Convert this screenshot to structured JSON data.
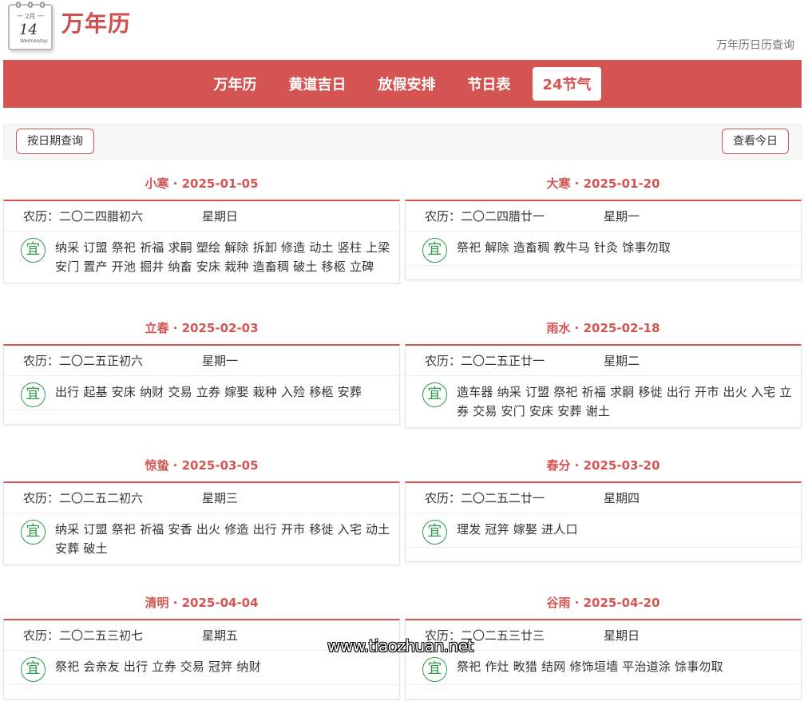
{
  "site": {
    "title": "万年历",
    "subtitle": "万年历日历查询",
    "logo": {
      "month": "一 2月 一",
      "day": "14",
      "week": "Wednesday"
    }
  },
  "nav": {
    "items": [
      {
        "label": "万年历",
        "active": false
      },
      {
        "label": "黄道吉日",
        "active": false
      },
      {
        "label": "放假安排",
        "active": false
      },
      {
        "label": "节日表",
        "active": false
      },
      {
        "label": "24节气",
        "active": true
      }
    ]
  },
  "toolbar": {
    "query_by_date": "按日期查询",
    "view_today": "查看今日"
  },
  "terms": [
    {
      "name": "小寒",
      "date": "2025-01-05",
      "header": "小寒 · 2025-01-05",
      "lunar": "农历：二〇二四腊初六",
      "weekday": "星期日",
      "yi": "纳采 订盟 祭祀 祈福 求嗣 塑绘 解除 拆卸 修造 动土 竖柱 上梁 安门 置产 开池 掘井 纳畜 安床 栽种 造畜稠 破土 移柩 立碑"
    },
    {
      "name": "大寒",
      "date": "2025-01-20",
      "header": "大寒 · 2025-01-20",
      "lunar": "农历：二〇二四腊廿一",
      "weekday": "星期一",
      "yi": "祭祀 解除 造畜稠 教牛马 针灸 馀事勿取"
    },
    {
      "name": "立春",
      "date": "2025-02-03",
      "header": "立春 · 2025-02-03",
      "lunar": "农历：二〇二五正初六",
      "weekday": "星期一",
      "yi": "出行 起基 安床 纳财 交易 立券 嫁娶 栽种 入殓 移柩 安葬"
    },
    {
      "name": "雨水",
      "date": "2025-02-18",
      "header": "雨水 · 2025-02-18",
      "lunar": "农历：二〇二五正廿一",
      "weekday": "星期二",
      "yi": "造车器 纳采 订盟 祭祀 祈福 求嗣 移徙 出行 开市 出火 入宅 立券 交易 安门 安床 安葬 谢土"
    },
    {
      "name": "惊蛰",
      "date": "2025-03-05",
      "header": "惊蛰 · 2025-03-05",
      "lunar": "农历：二〇二五二初六",
      "weekday": "星期三",
      "yi": "纳采 订盟 祭祀 祈福 安香 出火 修造 出行 开市 移徙 入宅 动土 安葬 破土"
    },
    {
      "name": "春分",
      "date": "2025-03-20",
      "header": "春分 · 2025-03-20",
      "lunar": "农历：二〇二五二廿一",
      "weekday": "星期四",
      "yi": "理发 冠笄 嫁娶 进人口"
    },
    {
      "name": "清明",
      "date": "2025-04-04",
      "header": "清明 · 2025-04-04",
      "lunar": "农历：二〇二五三初七",
      "weekday": "星期五",
      "yi": "祭祀 会亲友 出行 立券 交易 冠笄 纳财"
    },
    {
      "name": "谷雨",
      "date": "2025-04-20",
      "header": "谷雨 · 2025-04-20",
      "lunar": "农历：二〇二五三廿三",
      "weekday": "星期日",
      "yi": "祭祀 作灶 畋猎 结网 修饰垣墙 平治道涂 馀事勿取"
    }
  ],
  "yi_label": "宜",
  "watermark": "www.tiaozhuan.net",
  "colors": {
    "brand": "#d35451",
    "yi_green": "#2e9a4b"
  }
}
